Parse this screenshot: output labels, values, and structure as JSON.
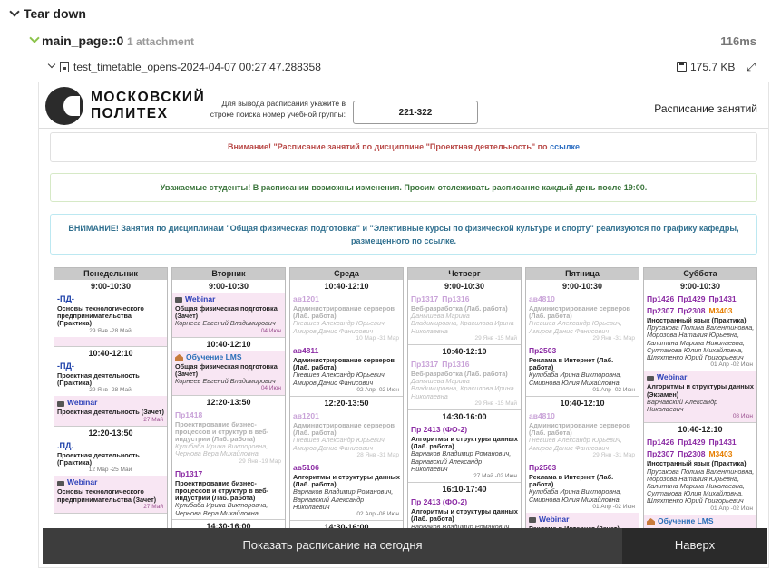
{
  "report": {
    "section_label": "Tear down",
    "step_name": "main_page::0",
    "step_attachments": "1 attachment",
    "step_duration": "116ms",
    "attachment_name": "test_timetable_opens-2024-04-07 00:27:47.288358",
    "attachment_size": "175.7 KB"
  },
  "site": {
    "logo_line1": "МОСКОВСКИЙ",
    "logo_line2": "ПОЛИТЕХ",
    "search_hint": "Для вывода расписания укажите в строке поиска номер учебной группы:",
    "search_value": "221-322",
    "header_link": "Расписание занятий",
    "notice1_text": "Внимание! \"Расписание занятий по дисциплине \"Проектная деятельность\" по ",
    "notice1_link": "ссылке",
    "notice2_text": "Уважаемые студенты! В расписании возможны изменения. Просим отслеживать расписание каждый день после 19:00.",
    "notice3_text": "ВНИМАНИЕ! Занятия по дисциплинам \"Общая физическая подготовка\" и \"Элективные курсы по физической культуре и спорту\" реализуются по графику кафедры, размещенного по ссылке.",
    "btn_today": "Показать расписание на сегодня",
    "btn_top": "Наверх"
  },
  "days": [
    {
      "name": "Понедельник",
      "slots": [
        {
          "time": "9:00-10:30",
          "lessons": [
            {
              "past": false,
              "exam": false,
              "kind": "pd",
              "label": "-ПД-",
              "subject": "Основы технологического предпринимательства (Практика)",
              "teacher": "",
              "dates": "29 Янв -28 Май",
              "center": true
            },
            {
              "past": false,
              "exam": true,
              "kind": "pd",
              "label": "",
              "subject": "",
              "teacher": "",
              "dates": "",
              "center": true
            }
          ]
        },
        {
          "time": "10:40-12:10",
          "lessons": [
            {
              "past": false,
              "exam": false,
              "kind": "pd",
              "label": "-ПД-",
              "subject": "Проектная деятельность (Практика)",
              "teacher": "",
              "dates": "29 Янв -28 Май",
              "center": true
            },
            {
              "past": false,
              "exam": true,
              "kind": "web",
              "label": "Webinar",
              "subject": "Проектная деятельность (Зачет)",
              "teacher": "",
              "dates": "27 Май",
              "center": false
            }
          ]
        },
        {
          "time": "12:20-13:50",
          "lessons": [
            {
              "past": false,
              "exam": false,
              "kind": "pd",
              "label": ".ПД.",
              "subject": "Проектная деятельность (Практика)",
              "teacher": "",
              "dates": "12 Мар -25 Май",
              "center": true
            },
            {
              "past": false,
              "exam": true,
              "kind": "web",
              "label": "Webinar",
              "subject": "Основы технологического предпринимательства (Зачет)",
              "teacher": "",
              "dates": "27 Май",
              "center": false
            }
          ]
        }
      ]
    },
    {
      "name": "Вторник",
      "slots": [
        {
          "time": "9:00-10:30",
          "lessons": [
            {
              "past": false,
              "exam": true,
              "kind": "web",
              "label": "Webinar",
              "subject": "Общая физическая подготовка (Зачет)",
              "teacher": "Корнеев Евгений Владимирович",
              "dates": "04 Июн",
              "center": false
            }
          ]
        },
        {
          "time": "10:40-12:10",
          "lessons": [
            {
              "past": false,
              "exam": true,
              "kind": "lms",
              "label": "Обучение LMS",
              "subject": "Общая физическая подготовка (Зачет)",
              "teacher": "Корнеев Евгений Владимирович",
              "dates": "04 Июн",
              "center": false
            }
          ]
        },
        {
          "time": "12:20-13:50",
          "lessons": [
            {
              "past": true,
              "exam": false,
              "kind": "room",
              "label": "Пр1418",
              "subject": "Проектирование бизнес-процессов и структур в веб-индустрии (Лаб. работа)",
              "teacher": "Кулибаба Ирина Викторовна, Чернова Вера Михайловна",
              "dates": "29 Янв -19 Мар",
              "center": false
            },
            {
              "past": false,
              "exam": false,
              "kind": "room",
              "label": "Пр1317",
              "subject": "Проектирование бизнес-процессов и структур в веб-индустрии (Лаб. работа)",
              "teacher": "Кулибаба Ирина Викторовна, Чернова Вера Михайловна",
              "dates": "",
              "center": false
            }
          ]
        },
        {
          "time": "14:30-16:00",
          "lessons": [
            {
              "past": true,
              "exam": false,
              "kind": "room",
              "label": "Пр1411",
              "subject": "",
              "teacher": "",
              "dates": "",
              "center": false
            }
          ]
        }
      ]
    },
    {
      "name": "Среда",
      "slots": [
        {
          "time": "10:40-12:10",
          "lessons": [
            {
              "past": true,
              "exam": false,
              "kind": "room",
              "label": "ав1201",
              "subject": "Администрирование серверов (Лаб. работа)",
              "teacher": "Гневшев Александр Юрьевич, Амиров Данис Фанисович",
              "dates": "10 Мар -31 Мар",
              "center": false
            },
            {
              "past": false,
              "exam": false,
              "kind": "room",
              "label": "ав4811",
              "subject": "Администрирование серверов (Лаб. работа)",
              "teacher": "Гневшев Александр Юрьевич, Амиров Данис Фанисович",
              "dates": "02 Апр -02 Июн",
              "center": false
            }
          ]
        },
        {
          "time": "12:20-13:50",
          "lessons": [
            {
              "past": true,
              "exam": false,
              "kind": "room",
              "label": "ав1201",
              "subject": "Администрирование серверов (Лаб. работа)",
              "teacher": "Гневшев Александр Юрьевич, Амиров Данис Фанисович",
              "dates": "28 Янв -31 Мар",
              "center": false
            },
            {
              "past": false,
              "exam": false,
              "kind": "room",
              "label": "ав5106",
              "subject": "Алгоритмы и структуры данных (Лаб. работа)",
              "teacher": "Варнаков Владимир Романович, Варнавский Александр Николаевич",
              "dates": "02 Апр -08 Июн",
              "center": false
            }
          ]
        },
        {
          "time": "14:30-16:00",
          "lessons": [
            {
              "past": true,
              "exam": false,
              "kind": "web",
              "label": "Webinar",
              "subject": "",
              "teacher": "",
              "dates": "",
              "center": false
            }
          ]
        }
      ]
    },
    {
      "name": "Четверг",
      "slots": [
        {
          "time": "9:00-10:30",
          "lessons": [
            {
              "past": true,
              "exam": false,
              "kind": "room2",
              "label": "Пр1317",
              "label2": "Пр1316",
              "subject": "Веб-разработка (Лаб. работа)",
              "teacher": "Данышева Марина Владимировна, Красилова Ирина Николаевна",
              "dates": "29 Янв -15 Май",
              "center": false
            }
          ]
        },
        {
          "time": "10:40-12:10",
          "lessons": [
            {
              "past": true,
              "exam": false,
              "kind": "room2",
              "label": "Пр1317",
              "label2": "Пр1316",
              "subject": "Веб-разработка (Лаб. работа)",
              "teacher": "Данышева Марина Владимировна, Красилова Ирина Николаевна",
              "dates": "29 Янв -15 Май",
              "center": false
            }
          ]
        },
        {
          "time": "14:30-16:00",
          "lessons": [
            {
              "past": false,
              "exam": false,
              "kind": "room",
              "label": "Пр 2413 (ФО-2)",
              "subject": "Алгоритмы и структуры данных (Лаб. работа)",
              "teacher": "Варнаков Владимир Романович, Варнавский Александр Николаевич",
              "dates": "27 Май -02 Июн",
              "center": false
            }
          ]
        },
        {
          "time": "16:10-17:40",
          "lessons": [
            {
              "past": false,
              "exam": false,
              "kind": "room",
              "label": "Пр 2413 (ФО-2)",
              "subject": "Алгоритмы и структуры данных (Лаб. работа)",
              "teacher": "Варнаков Владимир Романович, Варнавский Александр Николаевич",
              "dates": "27 Май -02 Июн",
              "center": false
            }
          ]
        }
      ]
    },
    {
      "name": "Пятница",
      "slots": [
        {
          "time": "9:00-10:30",
          "lessons": [
            {
              "past": true,
              "exam": false,
              "kind": "room",
              "label": "ав4810",
              "subject": "Администрирование серверов (Лаб. работа)",
              "teacher": "Гневшев Александр Юрьевич, Амиров Данис Фанисович",
              "dates": "29 Янв -31 Мар",
              "center": false
            },
            {
              "past": false,
              "exam": false,
              "kind": "room",
              "label": "Пр2503",
              "subject": "Реклама в Интернет (Лаб. работа)",
              "teacher": "Кулибаба Ирина Викторовна, Смирнова Юлия Михайловна",
              "dates": "01 Апр -02 Июн",
              "center": false
            }
          ]
        },
        {
          "time": "10:40-12:10",
          "lessons": [
            {
              "past": true,
              "exam": false,
              "kind": "room",
              "label": "ав4810",
              "subject": "Администрирование серверов (Лаб. работа)",
              "teacher": "Гневшев Александр Юрьевич, Амиров Данис Фанисович",
              "dates": "29 Янв -31 Мар",
              "center": false
            },
            {
              "past": false,
              "exam": false,
              "kind": "room",
              "label": "Пр2503",
              "subject": "Реклама в Интернет (Лаб. работа)",
              "teacher": "Кулибаба Ирина Викторовна, Смирнова Юлия Михайловна",
              "dates": "01 Апр -02 Июн",
              "center": false
            },
            {
              "past": false,
              "exam": true,
              "kind": "web",
              "label": "Webinar",
              "subject": "Реклама в Интернет (Зачет)",
              "teacher": "Смирнова Юлия Михайловна",
              "dates": "07 Июн",
              "center": false
            }
          ]
        }
      ]
    },
    {
      "name": "Суббота",
      "slots": [
        {
          "time": "9:00-10:30",
          "lessons": [
            {
              "past": false,
              "exam": false,
              "kind": "multi",
              "label": "",
              "subject": "Иностранный язык (Практика)",
              "teacher": "Прусакова Полина Валентиновна, Морозова Наталия Юрьевна, Калитина Марина Николаевна, Султанова Юлия Михайловна, Шляхтенко Юрий Григорьевич",
              "dates": "01 Апр -02 Июн",
              "center": false
            },
            {
              "past": false,
              "exam": true,
              "kind": "web",
              "label": "Webinar",
              "subject": "Алгоритмы и структуры данных (Экзамен)",
              "teacher": "Варнавский Александр Николаевич",
              "dates": "08 Июн",
              "center": false
            }
          ]
        },
        {
          "time": "10:40-12:10",
          "lessons": [
            {
              "past": false,
              "exam": false,
              "kind": "multi",
              "label": "",
              "subject": "Иностранный язык (Практика)",
              "teacher": "Прусакова Полина Валентиновна, Морозова Наталия Юрьевна, Калитина Марина Николаевна, Султанова Юлия Михайловна, Шляхтенко Юрий Григорьевич",
              "dates": "01 Апр -02 Июн",
              "center": false
            },
            {
              "past": false,
              "exam": true,
              "kind": "lms",
              "label": "Обучение LMS",
              "subject": "",
              "teacher": "",
              "dates": "",
              "center": false
            }
          ]
        }
      ]
    }
  ],
  "saturday_rooms": {
    "row1": [
      "Пр1426",
      "Пр1429",
      "Пр1431"
    ],
    "row2": [
      "Пр2307",
      "Пр2308"
    ],
    "row2_orange": "М3403"
  },
  "colors": {
    "room_tag": "#8a2aa3",
    "pd_tag": "#1a3ea8",
    "webinar": "#2b3fb8",
    "orange_room": "#e67e00",
    "exam_bg": "#f8e6f3",
    "bottom_bar": "#3d3d3d"
  }
}
